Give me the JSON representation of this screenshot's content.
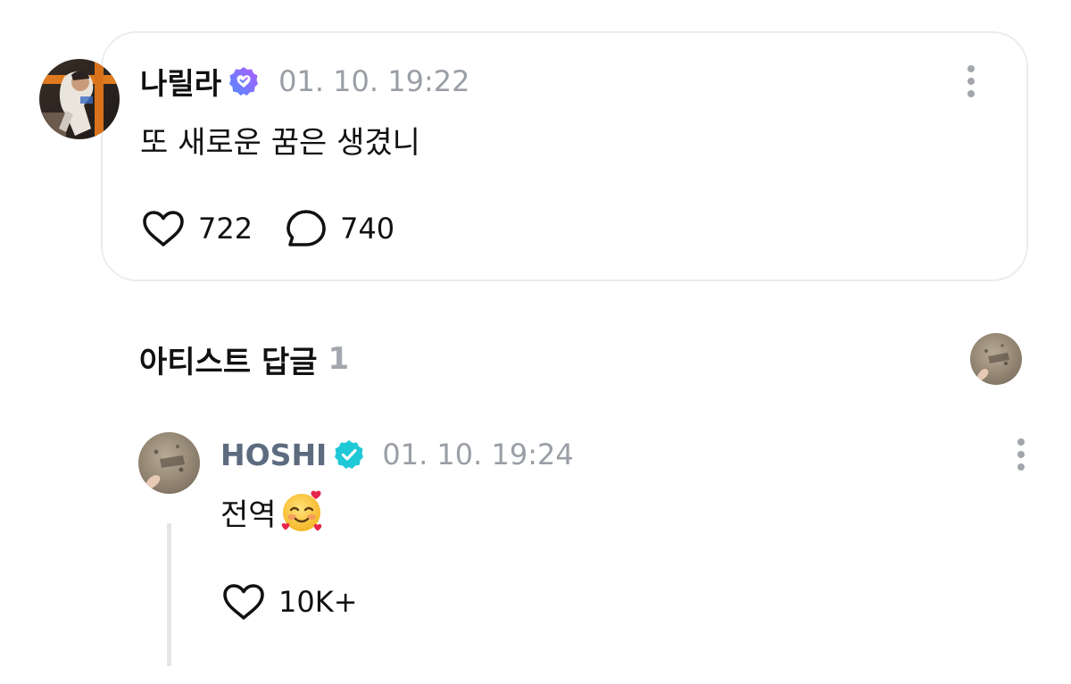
{
  "post": {
    "author": "나릴라",
    "author_badge": "heart-verified-icon",
    "timestamp": "01. 10. 19:22",
    "text": "또 새로운 꿈은 생겼니",
    "like_count": "722",
    "comment_count": "740"
  },
  "artist_replies": {
    "title": "아티스트 답글",
    "count": "1"
  },
  "reply": {
    "author": "HOSHI",
    "author_badge": "verified-check-icon",
    "timestamp": "01. 10. 19:24",
    "text": "전역",
    "emoji": "smiling-face-with-hearts",
    "like_count": "10K+"
  },
  "colors": {
    "badge_gradient_start": "#4f8cff",
    "badge_gradient_end": "#b05cff",
    "artist_badge": "#1fc8d6",
    "artist_name": "#5d6b7f",
    "muted_text": "#9a9ea6",
    "card_border": "#ececec"
  }
}
